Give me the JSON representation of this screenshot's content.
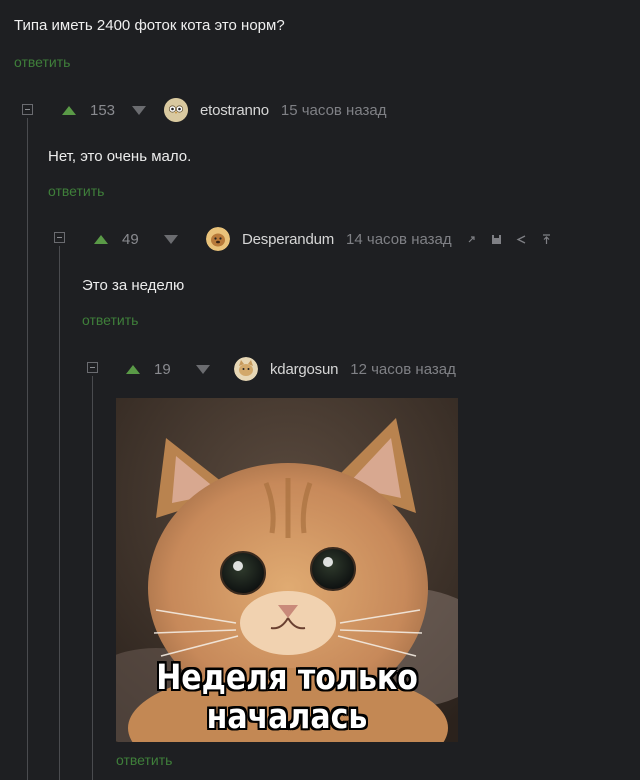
{
  "post": {
    "question": "Типа иметь 2400 фоток кота это норм?",
    "reply_label": "ответить"
  },
  "comments": [
    {
      "rating": "153",
      "username": "etostranno",
      "time": "15 часов назад",
      "text": "Нет, это очень мало.",
      "reply_label": "ответить"
    },
    {
      "rating": "49",
      "username": "Desperandum",
      "time": "14 часов назад",
      "text": "Это за неделю",
      "reply_label": "ответить",
      "tools": [
        "link-icon",
        "save-icon",
        "share-icon",
        "scroll-top-icon"
      ]
    },
    {
      "rating": "19",
      "username": "kdargosun",
      "time": "12 часов назад",
      "image_caption_line1": "Неделя только",
      "image_caption_line2": "началась",
      "reply_label": "ответить"
    }
  ],
  "colors": {
    "background": "#1e1f22",
    "reply_link": "#3f7f3a",
    "upvote": "#5a9a47",
    "downvote": "#6b6c70"
  }
}
